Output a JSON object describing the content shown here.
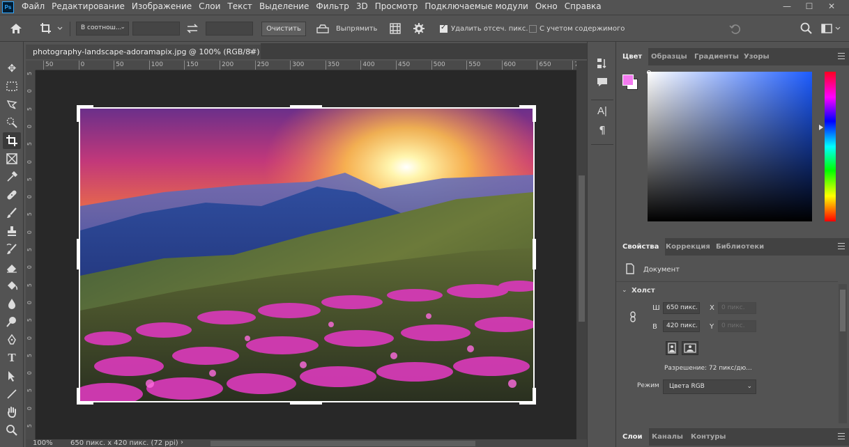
{
  "app": {
    "logo": "Ps"
  },
  "menu": [
    "Файл",
    "Редактирование",
    "Изображение",
    "Слои",
    "Текст",
    "Выделение",
    "Фильтр",
    "3D",
    "Просмотр",
    "Подключаемые модули",
    "Окно",
    "Справка"
  ],
  "window_controls": {
    "minimize": "—",
    "maximize": "☐",
    "close": "✕"
  },
  "options": {
    "ratio_select": "В соотнош...",
    "clear_button": "Очистить",
    "straighten_label": "Выпрямить",
    "delete_cropped_label": "Удалить отсеч. пикс.",
    "delete_cropped_checked": true,
    "content_aware_label": "С учетом содержимого",
    "content_aware_checked": false
  },
  "document": {
    "tab_title": "photography-landscape-adoramapix.jpg @ 100% (RGB/8#)",
    "tab_close": "×",
    "ruler_h_ticks": [
      "50",
      "0",
      "50",
      "100",
      "150",
      "200",
      "250",
      "300",
      "350",
      "400",
      "450",
      "500",
      "550",
      "600",
      "650",
      "700",
      "7("
    ],
    "ruler_v_ticks": [
      "5",
      "0",
      "5",
      "0",
      "5",
      "0",
      "5",
      "0",
      "5",
      "0",
      "5",
      "0",
      "5",
      "0",
      "5",
      "0",
      "5",
      "0",
      "5",
      "0",
      "5"
    ]
  },
  "status": {
    "zoom": "100%",
    "info": "650 пикс. x 420 пикс. (72 ppi)",
    "arrow": "›"
  },
  "color_panel": {
    "tabs": [
      "Цвет",
      "Образцы",
      "Градиенты",
      "Узоры"
    ],
    "active_tab": "Цвет",
    "foreground_color": "#f47af0",
    "background_color": "#ffffff"
  },
  "properties_panel": {
    "tabs": [
      "Свойства",
      "Коррекция",
      "Библиотеки"
    ],
    "active_tab": "Свойства",
    "type_label": "Документ",
    "section_title": "Холст",
    "width_label": "Ш",
    "width_value": "650 пикс.",
    "height_label": "В",
    "height_value": "420 пикс.",
    "x_label": "X",
    "x_value": "0 пикс.",
    "y_label": "Y",
    "y_value": "0 пикс.",
    "resolution": "Разрешение: 72 пикс/дю...",
    "mode_label": "Режим",
    "mode_value": "Цвета RGB"
  },
  "layers_panel": {
    "tabs": [
      "Слои",
      "Каналы",
      "Контуры"
    ],
    "active_tab": "Слои"
  }
}
